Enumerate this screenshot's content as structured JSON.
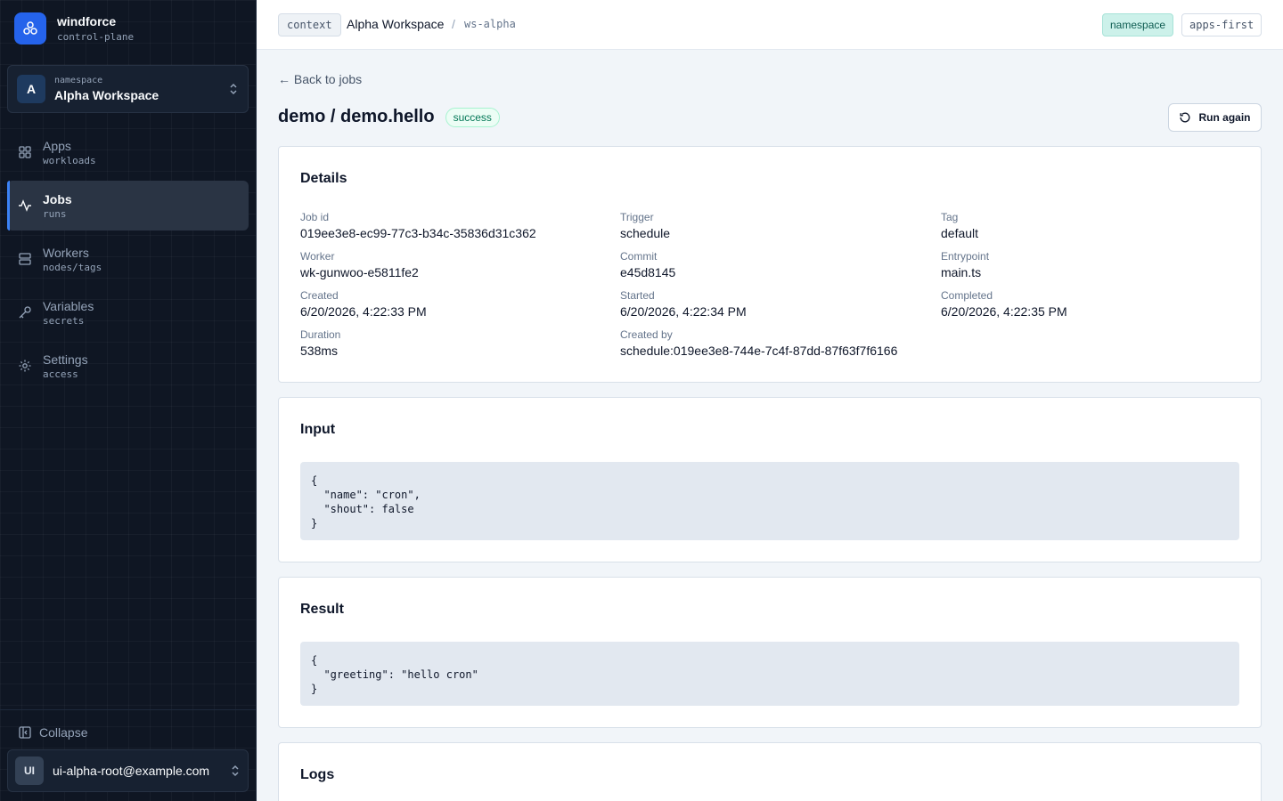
{
  "brand": {
    "name": "windforce",
    "sub": "control-plane"
  },
  "namespace": {
    "avatar": "A",
    "label": "namespace",
    "name": "Alpha Workspace"
  },
  "nav": [
    {
      "label": "Apps",
      "sub": "workloads"
    },
    {
      "label": "Jobs",
      "sub": "runs"
    },
    {
      "label": "Workers",
      "sub": "nodes/tags"
    },
    {
      "label": "Variables",
      "sub": "secrets"
    },
    {
      "label": "Settings",
      "sub": "access"
    }
  ],
  "collapse_label": "Collapse",
  "user": {
    "avatar": "UI",
    "email": "ui-alpha-root@example.com"
  },
  "topbar": {
    "context_badge": "context",
    "workspace": "Alpha Workspace",
    "separator": "/",
    "workspace_id": "ws-alpha",
    "chip_namespace": "namespace",
    "chip_apps": "apps-first"
  },
  "page": {
    "back": "← Back to jobs",
    "title": "demo / demo.hello",
    "status": "success",
    "run_again": "Run again"
  },
  "details": {
    "title": "Details",
    "fields": [
      {
        "label": "Job id",
        "value": "019ee3e8-ec99-77c3-b34c-35836d31c362"
      },
      {
        "label": "Trigger",
        "value": "schedule"
      },
      {
        "label": "Tag",
        "value": "default"
      },
      {
        "label": "Worker",
        "value": "wk-gunwoo-e5811fe2"
      },
      {
        "label": "Commit",
        "value": "e45d8145"
      },
      {
        "label": "Entrypoint",
        "value": "main.ts"
      },
      {
        "label": "Created",
        "value": "6/20/2026, 4:22:33 PM"
      },
      {
        "label": "Started",
        "value": "6/20/2026, 4:22:34 PM"
      },
      {
        "label": "Completed",
        "value": "6/20/2026, 4:22:35 PM"
      },
      {
        "label": "Duration",
        "value": "538ms"
      },
      {
        "label": "Created by",
        "value": "schedule:019ee3e8-744e-7c4f-87dd-87f63f7f6166"
      }
    ]
  },
  "input": {
    "title": "Input",
    "code": "{\n  \"name\": \"cron\",\n  \"shout\": false\n}"
  },
  "result": {
    "title": "Result",
    "code": "{\n  \"greeting\": \"hello cron\"\n}"
  },
  "logs": {
    "title": "Logs"
  }
}
